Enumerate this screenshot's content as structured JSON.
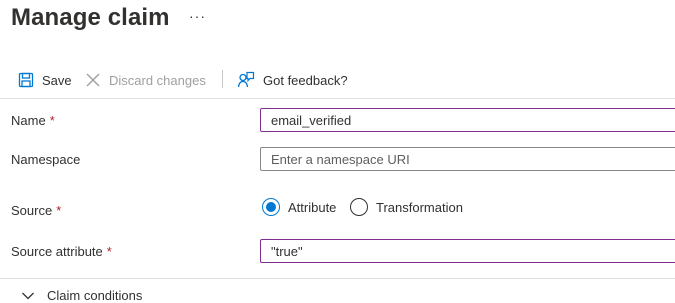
{
  "header": {
    "title": "Manage claim",
    "more_label": "···"
  },
  "toolbar": {
    "save_label": "Save",
    "discard_label": "Discard changes",
    "feedback_label": "Got feedback?"
  },
  "form": {
    "name": {
      "label": "Name",
      "required_mark": "*",
      "value": "email_verified"
    },
    "namespace": {
      "label": "Namespace",
      "placeholder": "Enter a namespace URI"
    },
    "source": {
      "label": "Source",
      "required_mark": "*",
      "options": [
        {
          "label": "Attribute",
          "selected": true
        },
        {
          "label": "Transformation",
          "selected": false
        }
      ]
    },
    "source_attribute": {
      "label": "Source attribute",
      "required_mark": "*",
      "value": "\"true\""
    }
  },
  "claim_conditions": {
    "label": "Claim conditions",
    "expanded": false
  },
  "colors": {
    "accent": "#0078d4",
    "filled_border": "#7f2d8f",
    "required": "#a4262c",
    "disabled_text": "#a19f9d"
  },
  "icons": {
    "more": "ellipsis-icon",
    "save": "save-icon",
    "discard": "close-icon",
    "feedback": "feedback-icon",
    "expander": "chevron-down-icon"
  }
}
